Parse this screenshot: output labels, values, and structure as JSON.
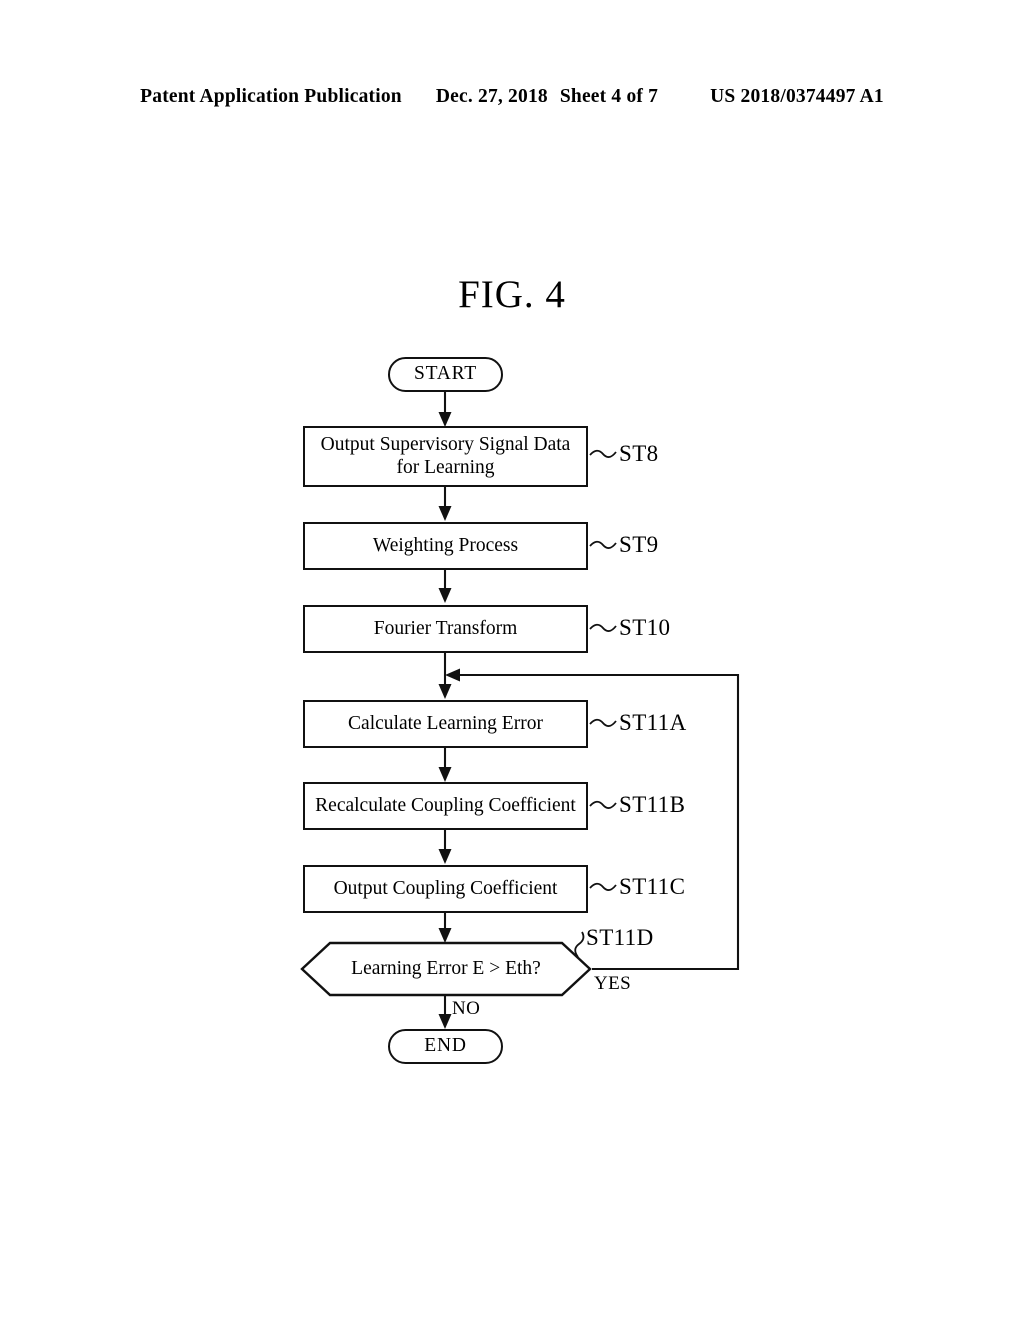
{
  "header": {
    "publication": "Patent Application Publication",
    "date": "Dec. 27, 2018",
    "sheet": "Sheet 4 of 7",
    "publication_number": "US 2018/0374497 A1"
  },
  "figure": {
    "title": "FIG. 4"
  },
  "flowchart": {
    "nodes": [
      {
        "id": "start",
        "type": "terminator",
        "label": "START",
        "step_ref": ""
      },
      {
        "id": "st8",
        "type": "process",
        "label": "Output Supervisory Signal Data for Learning",
        "step_ref": "ST8"
      },
      {
        "id": "st9",
        "type": "process",
        "label": "Weighting Process",
        "step_ref": "ST9"
      },
      {
        "id": "st10",
        "type": "process",
        "label": "Fourier Transform",
        "step_ref": "ST10"
      },
      {
        "id": "st11a",
        "type": "process",
        "label": "Calculate Learning Error",
        "step_ref": "ST11A"
      },
      {
        "id": "st11b",
        "type": "process",
        "label": "Recalculate Coupling Coefficient",
        "step_ref": "ST11B"
      },
      {
        "id": "st11c",
        "type": "process",
        "label": "Output Coupling Coefficient",
        "step_ref": "ST11C"
      },
      {
        "id": "st11d",
        "type": "decision",
        "label": "Learning Error E > Eth?",
        "step_ref": "ST11D"
      },
      {
        "id": "end",
        "type": "terminator",
        "label": "END",
        "step_ref": ""
      }
    ],
    "node_labels": {
      "start": "START",
      "st8_line1": "Output Supervisory Signal Data",
      "st8_line2": "for Learning",
      "st9": "Weighting Process",
      "st10": "Fourier Transform",
      "st11a": "Calculate Learning Error",
      "st11b": "Recalculate Coupling Coefficient",
      "st11c": "Output Coupling Coefficient",
      "st11d": "Learning Error E > Eth?",
      "end": "END"
    },
    "step_refs": {
      "st8": "ST8",
      "st9": "ST9",
      "st10": "ST10",
      "st11a": "ST11A",
      "st11b": "ST11B",
      "st11c": "ST11C",
      "st11d": "ST11D"
    },
    "branches": {
      "yes": "YES",
      "no": "NO"
    }
  },
  "colors": {
    "ink": "#111111",
    "paper": "#ffffff"
  }
}
